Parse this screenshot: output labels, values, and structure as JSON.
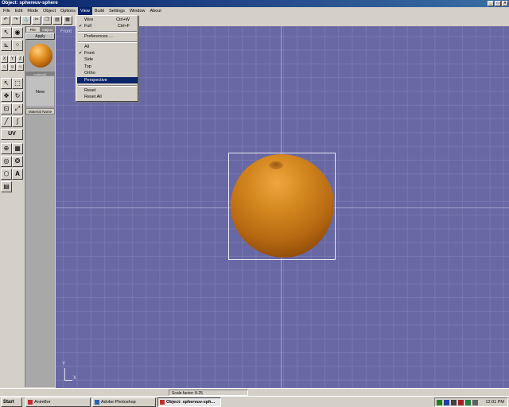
{
  "window": {
    "title": "Object: sphereuv-sphere"
  },
  "menubar": {
    "items": [
      {
        "label": "File",
        "open": false
      },
      {
        "label": "Edit",
        "open": false
      },
      {
        "label": "Mode",
        "open": false
      },
      {
        "label": "Object",
        "open": false
      },
      {
        "label": "Options",
        "open": false
      },
      {
        "label": "View",
        "open": true
      },
      {
        "label": "Build",
        "open": false
      },
      {
        "label": "Settings",
        "open": false
      },
      {
        "label": "Window",
        "open": false
      },
      {
        "label": "About",
        "open": false
      }
    ]
  },
  "view_menu": {
    "items": [
      {
        "label": "Wire",
        "shortcut": "Ctrl+W",
        "checked": false
      },
      {
        "label": "Full",
        "shortcut": "Ctrl+F",
        "checked": true
      },
      {
        "label": "Preferences ...",
        "shortcut": "",
        "checked": false
      },
      {
        "label": "All",
        "shortcut": "",
        "checked": false
      },
      {
        "label": "Front",
        "shortcut": "",
        "checked": true
      },
      {
        "label": "Side",
        "shortcut": "",
        "checked": false
      },
      {
        "label": "Top",
        "shortcut": "",
        "checked": false
      },
      {
        "label": "Ortho",
        "shortcut": "",
        "checked": false
      },
      {
        "label": "Perspective",
        "shortcut": "",
        "checked": false,
        "highlighted": true
      },
      {
        "label": "Reset",
        "shortcut": "",
        "checked": false
      },
      {
        "label": "Reset All",
        "shortcut": "",
        "checked": false
      }
    ],
    "check_glyph": "✔"
  },
  "tools": {
    "xyz": [
      "X",
      "Y",
      "Z"
    ],
    "uv_label": "UV",
    "text_tool": "A"
  },
  "material_panel": {
    "tabs": [
      "File",
      "Object"
    ],
    "apply_label": "Apply",
    "material_name": "material1",
    "new_label": "New",
    "name_label": "Material Name",
    "ball_color": "#d4871f"
  },
  "viewport": {
    "view_name": "Front",
    "background": "#6868a4",
    "object_color": "#c27518",
    "axis_y": "Y",
    "axis_x": "X"
  },
  "statusbar": {
    "scale_text": "Scale factor: 8.25"
  },
  "taskbar": {
    "start_label": "Start",
    "tasks": [
      {
        "label": "Anim8or",
        "active": false
      },
      {
        "label": "Adobe Photoshop",
        "active": false
      },
      {
        "label": "Object: sphereuv-sph...",
        "active": true
      }
    ],
    "clock": "12:01 PM"
  }
}
